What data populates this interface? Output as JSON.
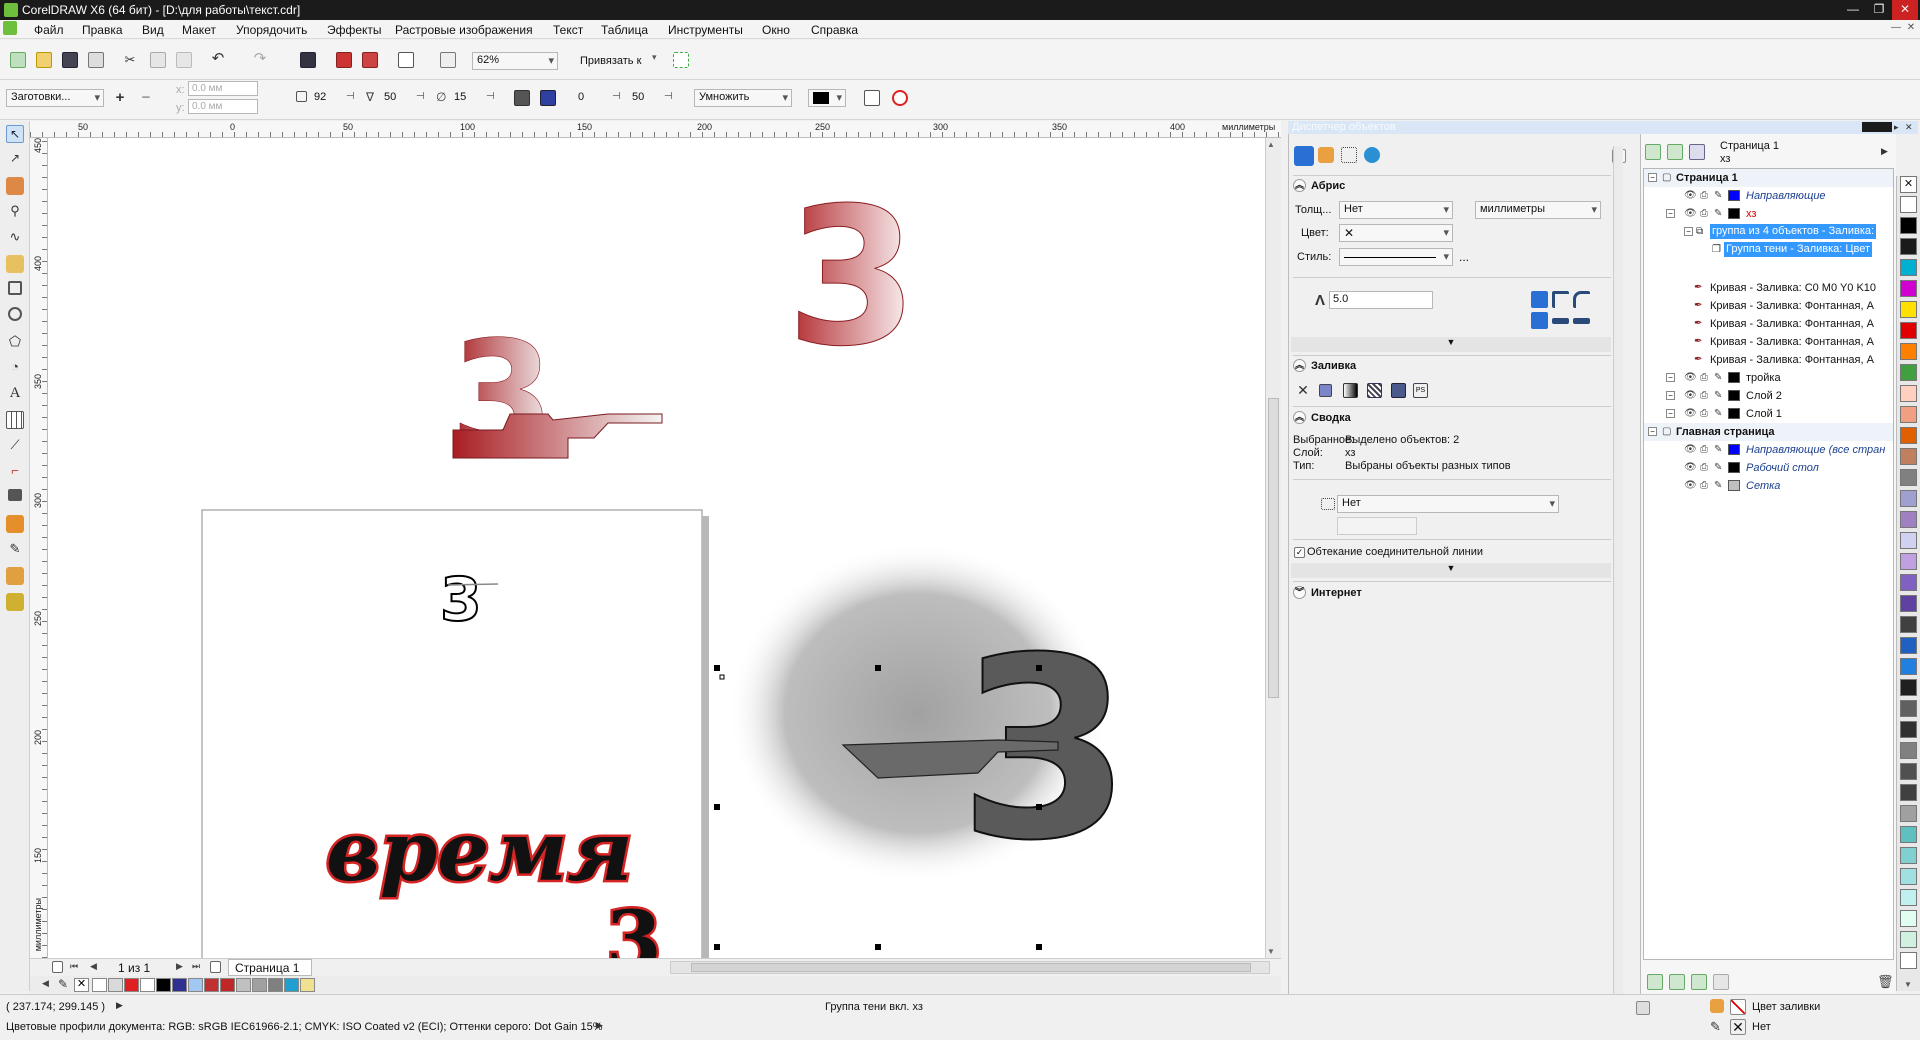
{
  "window": {
    "title": "CorelDRAW X6 (64 бит) - [D:\\для работы\\текст.cdr]"
  },
  "menu": [
    "Файл",
    "Правка",
    "Вид",
    "Макет",
    "Упорядочить",
    "Эффекты",
    "Растровые изображения",
    "Текст",
    "Таблица",
    "Инструменты",
    "Окно",
    "Справка"
  ],
  "toolbar1": {
    "zoom": "62%",
    "snap_label": "Привязать к"
  },
  "toolbar2": {
    "presets": "Заготовки...",
    "x_value": "0.0 мм",
    "y_value": "0.0 мм",
    "val1": "92",
    "val2": "50",
    "val3": "15",
    "offset1": "0",
    "offset2": "50",
    "blend_mode": "Умножить"
  },
  "ruler": {
    "h_ticks": [
      "50",
      "0",
      "50",
      "100",
      "150",
      "200",
      "250",
      "300",
      "350",
      "400"
    ],
    "unit": "миллиметры",
    "v_ticks": [
      "450",
      "400",
      "350",
      "300",
      "250",
      "200",
      "150"
    ],
    "v_unit": "миллиметры"
  },
  "canvas": {
    "digit_large": "3",
    "digit_small": "3",
    "digit_shadow": "3",
    "word": "время",
    "word_partial": "3"
  },
  "page_nav": {
    "page_count": "1 из 1",
    "tab": "Страница 1"
  },
  "palette_colors": [
    "#ffffff",
    "#d9d9d9",
    "#e02020",
    "#ffffff",
    "#000000",
    "#303090",
    "#a0c8f0",
    "#c03030",
    "#c02828",
    "#c0c0c0",
    "#a0a0a0",
    "#808080",
    "#20a0d0",
    "#f0e090"
  ],
  "docker": {
    "title": "Диспетчер объектов",
    "outline": {
      "header": "Абрис",
      "width_label": "Толщ...",
      "width_value": "Нет",
      "units_value": "миллиметры",
      "color_label": "Цвет:",
      "style_label": "Стиль:",
      "style_more": "...",
      "miter_value": "5.0"
    },
    "fill": {
      "header": "Заливка"
    },
    "summary": {
      "header": "Сводка",
      "selected_label": "Выбранное:",
      "selected_value": "Выделено объектов: 2",
      "layer_label": "Слой:",
      "layer_value": "хз",
      "type_label": "Тип:",
      "type_value": "Выбраны объекты разных типов",
      "wrap_value": "Нет",
      "connector_wrap": "Обтекание соединительной линии"
    },
    "internet": {
      "header": "Интернет"
    }
  },
  "objects": {
    "page_name": "Страница 1",
    "page_sub": "хз",
    "rows": [
      {
        "label": "Страница 1",
        "indent": 0,
        "bold": true,
        "color": "#000000"
      },
      {
        "label": "Направляющие",
        "indent": 1,
        "italic": true,
        "color": "#0000ff",
        "text_color": "#1a3f8f"
      },
      {
        "label": "хз",
        "indent": 1,
        "color": "#000000",
        "text_color": "#cc0000"
      },
      {
        "label": "группа из 4 объектов - Заливка:",
        "indent": 2,
        "selected": true
      },
      {
        "label": "Группа тени - Заливка: Цвет",
        "indent": 3,
        "selected": true
      },
      {
        "label": "Кривая - Заливка: C0 M0 Y0 K10",
        "indent": 3
      },
      {
        "label": "Кривая - Заливка: Фонтанная, А",
        "indent": 3
      },
      {
        "label": "Кривая - Заливка: Фонтанная, А",
        "indent": 3
      },
      {
        "label": "Кривая - Заливка: Фонтанная, А",
        "indent": 3
      },
      {
        "label": "Кривая - Заливка: Фонтанная, А",
        "indent": 3
      },
      {
        "label": "тройка",
        "indent": 1,
        "color": "#000000"
      },
      {
        "label": "Слой 2",
        "indent": 1,
        "color": "#000000"
      },
      {
        "label": "Слой 1",
        "indent": 1,
        "color": "#000000"
      },
      {
        "label": "Главная страница",
        "indent": 0,
        "bold": true
      },
      {
        "label": "Направляющие (все стран",
        "indent": 1,
        "italic": true,
        "color": "#0000ff",
        "text_color": "#1a3f8f"
      },
      {
        "label": "Рабочий стол",
        "indent": 1,
        "italic": true,
        "color": "#000000",
        "text_color": "#1a3f8f"
      },
      {
        "label": "Сетка",
        "indent": 1,
        "italic": true,
        "color": "#c0c0c0",
        "text_color": "#1a3f8f"
      }
    ]
  },
  "right_palette": [
    "#ffffff",
    "#000000",
    "#1a1a1a",
    "#00b0d0",
    "#d000d0",
    "#ffe000",
    "#e00000",
    "#ff8000",
    "#40a040",
    "#ffd0c0",
    "#f0a080",
    "#e06000",
    "#c08060",
    "#808080",
    "#a0a0d0",
    "#a080c0",
    "#d0d0f0",
    "#c0a0e0",
    "#8060c0",
    "#6040a0",
    "#404040",
    "#2060c0",
    "#2080e0",
    "#202020",
    "#606060",
    "#303030",
    "#808080",
    "#505050",
    "#404040",
    "#a0a0a0",
    "#60c0c0",
    "#80d0d0",
    "#a0e0e0",
    "#c0f0f0",
    "#e0fff0",
    "#d0f0e0",
    "#ffffff"
  ],
  "status": {
    "coords": "( 237.174; 299.145 )",
    "selection": "Группа тени  вкл. хз",
    "profiles": "Цветовые профили документа: RGB: sRGB IEC61966-2.1; CMYK: ISO Coated v2 (ECI); Оттенки серого: Dot Gain 15%",
    "fill_label": "Цвет заливки",
    "outline_label": "Нет"
  }
}
